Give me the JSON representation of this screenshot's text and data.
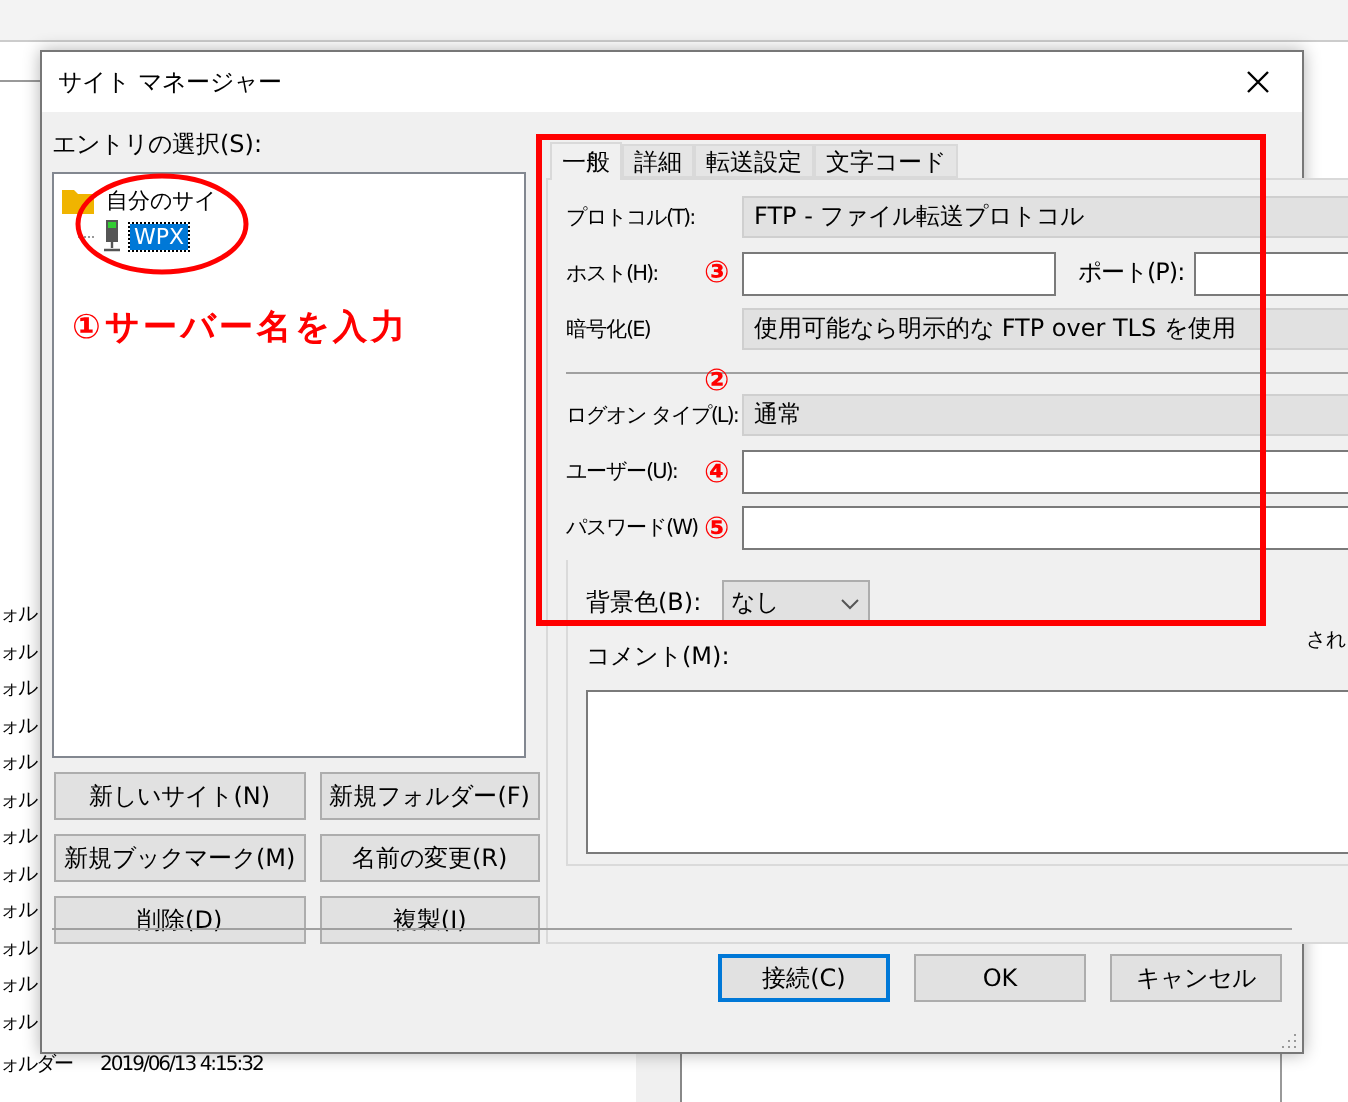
{
  "background": {
    "left_rows": [
      "ォル",
      "ォル",
      "ォル",
      "ォル",
      "ォル",
      "ォル",
      "ォル",
      "ォル",
      "ォル",
      "ォル",
      "ォル",
      "ォル"
    ],
    "last_row": {
      "type": "ォルダー",
      "date": "2019/06/13 4:15:32"
    },
    "right_text": "され"
  },
  "dialog": {
    "title": "サイト マネージャー",
    "entry_label": "エントリの選択(S):",
    "tree": [
      {
        "label": "自分のサイ",
        "expanded": true,
        "selected": false,
        "children": [
          {
            "label": "WPX",
            "selected": true
          }
        ]
      }
    ],
    "left_buttons": [
      "新しいサイト(N)",
      "新規フォルダー(F)",
      "新規ブックマーク(M)",
      "名前の変更(R)",
      "削除(D)",
      "複製(I)"
    ],
    "tabs": [
      {
        "label": "一般",
        "selected": true
      },
      {
        "label": "詳細",
        "selected": false
      },
      {
        "label": "転送設定",
        "selected": false
      },
      {
        "label": "文字コード",
        "selected": false
      }
    ],
    "connection_rows": [
      {
        "kind": "combo",
        "label": "プロトコル(T):",
        "value": "FTP - ファイル転送プロトコル"
      },
      {
        "kind": "host",
        "label": "ホスト(H):",
        "port_label": "ポート(P):",
        "marker": "③"
      },
      {
        "kind": "combo",
        "label": "暗号化(E)",
        "value": "使用可能なら明示的な FTP over TLS を使用"
      }
    ],
    "login_rows": [
      {
        "kind": "combo",
        "label": "ログオン タイプ(L):",
        "value": "通常",
        "marker": "②"
      },
      {
        "kind": "input",
        "label": "ユーザー(U):",
        "marker": "④"
      },
      {
        "kind": "input",
        "label": "パスワード(W)",
        "marker": "⑤"
      }
    ],
    "background_color": {
      "label": "背景色(B):",
      "value": "なし"
    },
    "comment": {
      "label": "コメント(M):"
    },
    "buttons": [
      {
        "label": "接続(C)",
        "default": true
      },
      {
        "label": "OK",
        "default": false
      },
      {
        "label": "キャンセル",
        "default": false
      }
    ]
  },
  "annotations": {
    "caption": "①サーバー名を入力"
  }
}
